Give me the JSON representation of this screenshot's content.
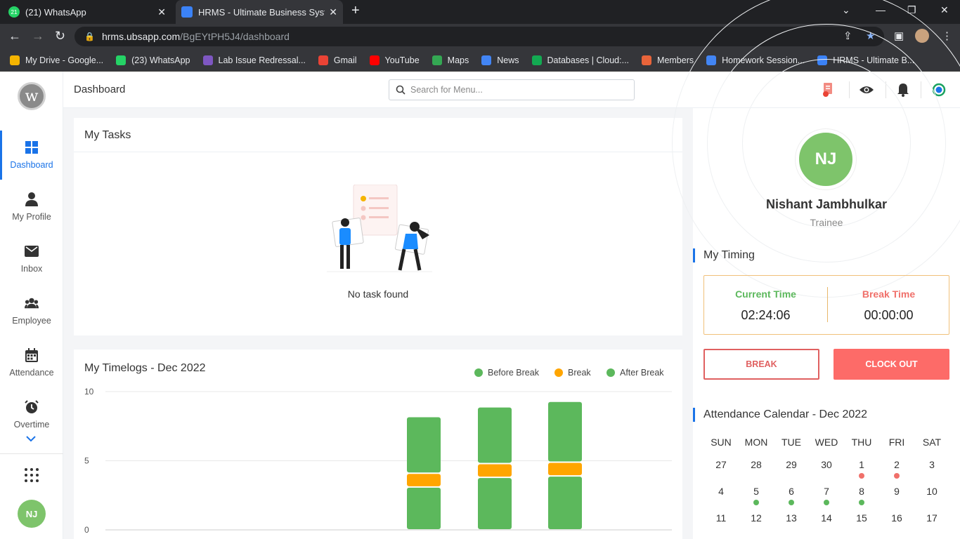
{
  "browser": {
    "tabs": [
      {
        "title": "(21) WhatsApp",
        "badge": "21"
      },
      {
        "title": "HRMS - Ultimate Business Systen"
      }
    ],
    "url_host": "hrms.ubsapp.com",
    "url_path": "/BgEYtPH5J4/dashboard",
    "bookmarks": [
      {
        "label": "My Drive - Google...",
        "color": "#f4b400"
      },
      {
        "label": "(23) WhatsApp",
        "color": "#25d366"
      },
      {
        "label": "Lab Issue Redressal...",
        "color": "#7e57c2"
      },
      {
        "label": "Gmail",
        "color": "#ea4335"
      },
      {
        "label": "YouTube",
        "color": "#ff0000"
      },
      {
        "label": "Maps",
        "color": "#34a853"
      },
      {
        "label": "News",
        "color": "#4285f4"
      },
      {
        "label": "Databases | Cloud:...",
        "color": "#13aa52"
      },
      {
        "label": "Members",
        "color": "#e8643a"
      },
      {
        "label": "Homework Session...",
        "color": "#4285f4"
      },
      {
        "label": "HRMS - Ultimate B...",
        "color": "#3b82f6"
      }
    ]
  },
  "app": {
    "logo": "w",
    "page_title": "Dashboard",
    "search_placeholder": "Search for Menu...",
    "nav": [
      {
        "label": "Dashboard",
        "icon": "grid-icon"
      },
      {
        "label": "My Profile",
        "icon": "person-icon"
      },
      {
        "label": "Inbox",
        "icon": "mail-icon"
      },
      {
        "label": "Employee",
        "icon": "group-icon"
      },
      {
        "label": "Attendance",
        "icon": "calendar-icon"
      },
      {
        "label": "Overtime",
        "icon": "clock-icon"
      }
    ],
    "user_initials": "NJ"
  },
  "tasks": {
    "title": "My Tasks",
    "empty_text": "No task found"
  },
  "timelogs": {
    "title": "My Timelogs - Dec 2022",
    "legend": [
      {
        "label": "Before Break",
        "color": "#5cb85c"
      },
      {
        "label": "Break",
        "color": "#ffa500"
      },
      {
        "label": "After Break",
        "color": "#5cb85c"
      }
    ]
  },
  "chart_data": {
    "type": "bar",
    "stacked": true,
    "yticks": [
      "10",
      "5",
      "0"
    ],
    "ylim": [
      0,
      10
    ],
    "bars": [
      {
        "before": 3.1,
        "break": 1.0,
        "after": 4.1
      },
      {
        "before": 3.8,
        "break": 1.0,
        "after": 4.1
      },
      {
        "before": 3.9,
        "break": 1.0,
        "after": 4.4
      }
    ],
    "colors": {
      "before": "#5cb85c",
      "break": "#ffa500",
      "after": "#5cb85c"
    }
  },
  "profile": {
    "initials": "NJ",
    "name": "Nishant Jambhulkar",
    "role": "Trainee"
  },
  "timing": {
    "title": "My Timing",
    "current_label": "Current Time",
    "current_value": "02:24:06",
    "break_label": "Break Time",
    "break_value": "00:00:00",
    "break_button": "BREAK",
    "clockout_button": "CLOCK OUT"
  },
  "calendar": {
    "title": "Attendance Calendar - Dec 2022",
    "days": [
      "SUN",
      "MON",
      "TUE",
      "WED",
      "THU",
      "FRI",
      "SAT"
    ],
    "weeks": [
      [
        {
          "d": "27",
          "muted": true
        },
        {
          "d": "28",
          "muted": true
        },
        {
          "d": "29",
          "muted": true
        },
        {
          "d": "30",
          "muted": true
        },
        {
          "d": "1",
          "mark": "red"
        },
        {
          "d": "2",
          "mark": "red"
        },
        {
          "d": "3"
        }
      ],
      [
        {
          "d": "4"
        },
        {
          "d": "5",
          "mark": "green"
        },
        {
          "d": "6",
          "mark": "green"
        },
        {
          "d": "7",
          "mark": "green"
        },
        {
          "d": "8",
          "mark": "green"
        },
        {
          "d": "9"
        },
        {
          "d": "10"
        }
      ],
      [
        {
          "d": "11"
        },
        {
          "d": "12"
        },
        {
          "d": "13"
        },
        {
          "d": "14"
        },
        {
          "d": "15"
        },
        {
          "d": "16"
        },
        {
          "d": "17"
        }
      ]
    ]
  }
}
